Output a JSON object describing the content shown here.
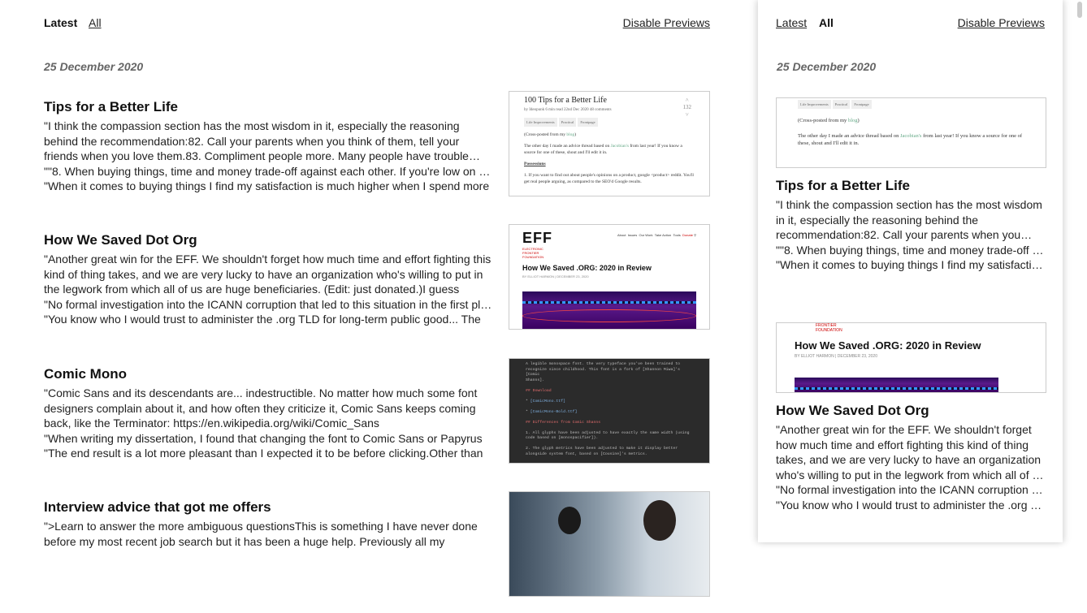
{
  "main": {
    "tabs": [
      {
        "label": "Latest",
        "active": true
      },
      {
        "label": "All",
        "active": false
      }
    ],
    "disable_previews": "Disable Previews",
    "date": "25 December 2020",
    "entries": [
      {
        "title": "Tips for a Better Life",
        "quotes": [
          "\"I think the compassion section has the most wisdom in it, especially the reasoning behind the recommendation:82. Call your parents when you think of them, tell your friends when you love them.83. Compliment people more. Many people have trouble accepting compliments.",
          "\"\"8. When buying things, time and money trade-off against each other. If you're low on money, buy cheaper",
          "\"When it comes to buying things I find my satisfaction is much higher when I spend more"
        ]
      },
      {
        "title": "How We Saved Dot Org",
        "quotes": [
          "\"Another great win for the EFF. We shouldn't forget how much time and effort fighting this kind of thing takes, and we are very lucky to have an organization who's willing to put in the legwork from which all of us are huge beneficiaries. (Edit: just donated.)I guess",
          "\"No formal investigation into the ICANN corruption that led to this situation in the first place",
          "\"You know who I would trust to administer the .org TLD for long-term public good... The"
        ]
      },
      {
        "title": "Comic Mono",
        "quotes": [
          "\"Comic Sans and its descendants are... indestructible. No matter how much some font designers complain about it, and how often they criticize it, Comic Sans keeps coming back, like the Terminator: https://en.wikipedia.org/wiki/Comic_Sans",
          "\"When writing my dissertation, I found that changing the font to Comic Sans or Papyrus",
          "\"The end result is a lot more pleasant than I expected it to be before clicking.Other than"
        ]
      },
      {
        "title": "Interview advice that got me offers",
        "quotes": [
          "\">Learn to answer the more ambiguous questionsThis is something I have never done before my most recent job search but it has been a huge help. Previously all my"
        ]
      }
    ]
  },
  "thumbs": {
    "lw": {
      "title": "100 Tips for a Better Life",
      "meta": "by Ideopunk   6 min read   22nd Dec 2020   48 comments",
      "tags": [
        "Life Improvements",
        "Practical",
        "Frontpage"
      ],
      "crosspost_a": "(Cross-posted from my ",
      "crosspost_link": "blog",
      "crosspost_b": ")",
      "p1_a": "The other day I made an advice thread based on ",
      "p1_link": "Jacobian's",
      "p1_b": " from last year! If you know a source for one of these, shout and I'll edit it in.",
      "section": "Possessions",
      "p2": "1. If you want to find out about people's opinions on a product, google <product> reddit. You'll get real people arguing, as compared to the SEO'd Google results.",
      "score": "132"
    },
    "eff": {
      "logo": "EFF",
      "sub": [
        "ELECTRONIC",
        "FRONTIER",
        "FOUNDATION"
      ],
      "nav": [
        "About",
        "Issues",
        "Our Work",
        "Take Action",
        "Tools"
      ],
      "donate": "Donate",
      "headline": "How We Saved .ORG: 2020 in Review",
      "byline": "BY ELLIOT HARMON  |  DECEMBER 23, 2020"
    },
    "code": {
      "lines": [
        "A legible monospace font. the very typeface you've been trained to",
        "recognize since childhood. This font is a fork of [Shannon Miwa]'s [Comic",
        "Shanns]."
      ],
      "h1": "## Download",
      "links": [
        "[ComicMono.ttf]",
        "[ComicMono-Bold.ttf]"
      ],
      "h2": "## Differences from Comic Shanns",
      "l1": "1. All glyphs have been adjusted to have exactly the same width (using",
      "l1b": "code based on [monospacifier]).",
      "l2": "2. The glyph metrics have been adjusted to make it display better",
      "l2b": "alongside system font, based on [Cousine]'s metrics."
    }
  },
  "sidebar": {
    "tabs": [
      {
        "label": "Latest",
        "active": false
      },
      {
        "label": "All",
        "active": true
      }
    ],
    "disable_previews": "Disable Previews",
    "date": "25 December 2020",
    "cards": [
      {
        "title": "Tips for a Better Life",
        "quotes": [
          "\"I think the compassion section has the most wisdom in it, especially the reasoning behind the recommendation:82. Call your parents when you think of them, tell your friends when you love them.",
          "\"\"8. When buying things, time and money trade-off against each other.",
          "\"When it comes to buying things I find my satisfaction is much higher"
        ]
      },
      {
        "title": "How We Saved Dot Org",
        "quotes": [
          "\"Another great win for the EFF. We shouldn't forget how much time and effort fighting this kind of thing takes, and we are very lucky to have an organization who's willing to put in the legwork from which all of us are huge beneficiaries.",
          "\"No formal investigation into the ICANN corruption that led to this situation",
          "\"You know who I would trust to administer the .org TLD for long-term public good"
        ]
      }
    ]
  }
}
